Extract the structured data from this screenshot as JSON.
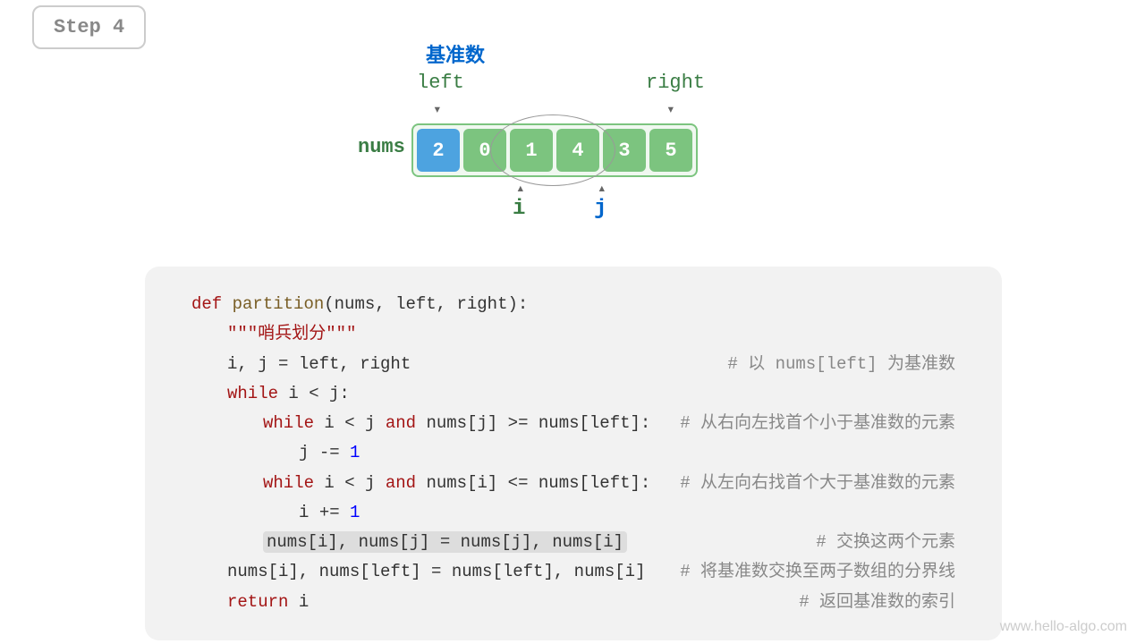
{
  "step": {
    "label": "Step 4"
  },
  "diagram": {
    "pivot_label": "基准数",
    "left_label": "left",
    "right_label": "right",
    "nums_label": "nums",
    "array": [
      "2",
      "0",
      "1",
      "4",
      "3",
      "5"
    ],
    "pivot_index": 0,
    "i_label": "i",
    "j_label": "j",
    "i_index": 2,
    "j_index": 3
  },
  "code": {
    "def": "def",
    "fn": "partition",
    "params": "(nums, left, right):",
    "docstring": "\"\"\"哨兵划分\"\"\"",
    "l1": "i, j = left, right",
    "c1": "#  以 nums[left] 为基准数",
    "l2a": "while",
    "l2b": " i < j:",
    "l3a": "while",
    "l3b": " i < j ",
    "l3c": "and",
    "l3d": " nums[j] >= nums[left]:",
    "c3": "#  从右向左找首个小于基准数的元素",
    "l4a": "j ",
    "l4b": "-=",
    "l4c": " 1",
    "l5a": "while",
    "l5b": " i < j ",
    "l5c": "and",
    "l5d": " nums[i] <= nums[left]:",
    "c5": "#  从左向右找首个大于基准数的元素",
    "l6a": "i ",
    "l6b": "+=",
    "l6c": " 1",
    "l7": "nums[i], nums[j] = nums[j], nums[i]",
    "c7": "#  交换这两个元素",
    "l8": "nums[i], nums[left] = nums[left], nums[i]",
    "c8": "#  将基准数交换至两子数组的分界线",
    "l9a": "return",
    "l9b": " i",
    "c9": "#  返回基准数的索引"
  },
  "watermark": "www.hello-algo.com"
}
